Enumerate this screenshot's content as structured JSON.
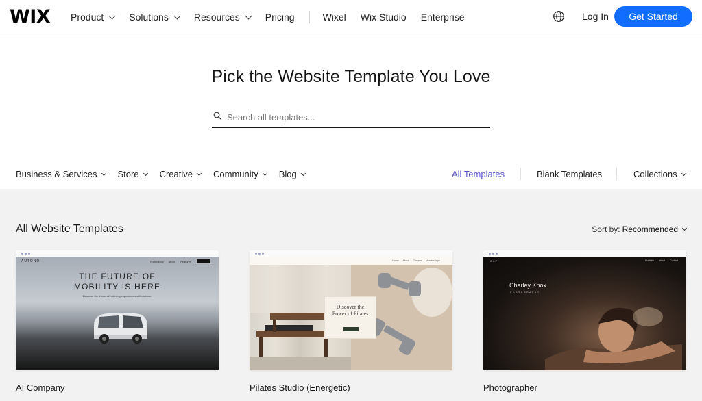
{
  "brand": {
    "logo": "WIX"
  },
  "nav": {
    "items": [
      {
        "label": "Product",
        "dropdown": true
      },
      {
        "label": "Solutions",
        "dropdown": true
      },
      {
        "label": "Resources",
        "dropdown": true
      },
      {
        "label": "Pricing",
        "dropdown": false
      }
    ],
    "secondary": [
      "Wixel",
      "Wix Studio",
      "Enterprise"
    ],
    "login_label": "Log In",
    "cta_label": "Get Started",
    "globe_icon": "globe-icon"
  },
  "hero": {
    "title": "Pick the Website Template You Love",
    "search_placeholder": "Search all templates..."
  },
  "categories": {
    "items": [
      {
        "label": "Business & Services"
      },
      {
        "label": "Store"
      },
      {
        "label": "Creative"
      },
      {
        "label": "Community"
      },
      {
        "label": "Blog"
      }
    ],
    "all_templates": "All Templates",
    "blank_templates": "Blank Templates",
    "collections": "Collections"
  },
  "gallery": {
    "title": "All Website Templates",
    "sort_prefix": "Sort by:",
    "sort_value": "Recommended",
    "cards": [
      {
        "label": "AI Company",
        "preview": {
          "brand": "AUTONO",
          "nav_links": "Technology About Features",
          "headline_1": "THE FUTURE OF",
          "headline_2": "MOBILITY IS HERE",
          "subtext": "Discover the future with driving experiences with Autono."
        }
      },
      {
        "label": "Pilates Studio (Energetic)",
        "preview": {
          "nav_links": "Home About Classes Memberships",
          "promo_title_1": "Discover the",
          "promo_title_2": "Power of Pilates"
        }
      },
      {
        "label": "Photographer",
        "preview": {
          "brand": "CKP",
          "nav_links": "Portfolio About Contact",
          "name": "Charley Knox",
          "role": "PHOTOGRAPHY"
        }
      }
    ]
  },
  "colors": {
    "accent": "#116dff",
    "active_link": "#5a59c8",
    "gallery_bg": "#f3f2f2"
  }
}
